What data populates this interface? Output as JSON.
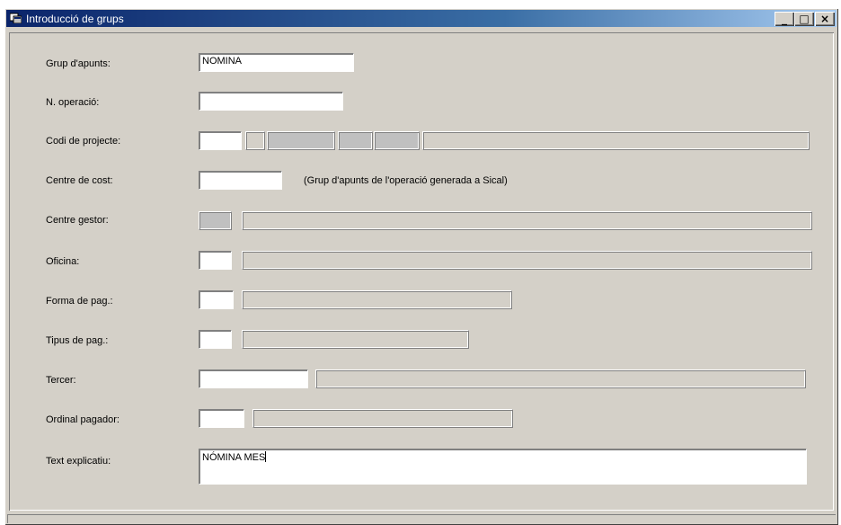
{
  "window": {
    "title": "Introducció de grups",
    "icon": "app-icon",
    "controls": {
      "minimize": "_",
      "maximize": "□",
      "close": "×"
    }
  },
  "form": {
    "grup_apunts": {
      "label": "Grup d'apunts:",
      "value": "NOMINA"
    },
    "n_operacio": {
      "label": "N. operació:",
      "value": ""
    },
    "codi_projecte": {
      "label": "Codi de projecte:",
      "value": ""
    },
    "centre_cost": {
      "label": "Centre de cost:",
      "value": "",
      "note": "(Grup d'apunts de l'operació generada a Sical)"
    },
    "centre_gestor": {
      "label": "Centre gestor:",
      "value": ""
    },
    "oficina": {
      "label": "Oficina:",
      "value": ""
    },
    "forma_pag": {
      "label": "Forma de pag.:",
      "value": ""
    },
    "tipus_pag": {
      "label": "Tipus de pag.:",
      "value": ""
    },
    "tercer": {
      "label": "Tercer:",
      "value": ""
    },
    "ordinal_pagador": {
      "label": "Ordinal pagador:",
      "value": ""
    },
    "text_explicatiu": {
      "label": "Text explicatiu:",
      "value": "NÓMINA MES"
    }
  },
  "colors": {
    "titlebar_start": "#0a246a",
    "titlebar_end": "#a6caf0",
    "face": "#d4d0c8"
  }
}
